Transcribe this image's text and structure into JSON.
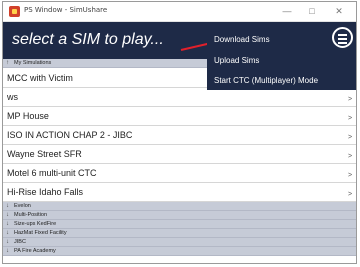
{
  "window": {
    "title": "PS Window - SimUshare",
    "minimize_glyph": "—",
    "maximize_glyph": "□",
    "close_glyph": "✕"
  },
  "header": {
    "title": "select a SIM to play..."
  },
  "menu": {
    "items": [
      {
        "label": "Download Sims"
      },
      {
        "label": "Upload Sims"
      },
      {
        "label": "Start CTC (Multiplayer) Mode"
      }
    ]
  },
  "my_simulations": {
    "caret": "↑",
    "label": "My Simulations",
    "items": [
      {
        "name": "MCC with Victim",
        "chevron": ">"
      },
      {
        "name": "ws",
        "chevron": ">"
      },
      {
        "name": "MP House",
        "chevron": ">"
      },
      {
        "name": "ISO IN ACTION CHAP 2 - JIBC",
        "chevron": ">"
      },
      {
        "name": "Wayne Street SFR",
        "chevron": ">"
      },
      {
        "name": "Motel 6 multi-unit CTC",
        "chevron": ">"
      },
      {
        "name": "Hi-Rise Idaho Falls",
        "chevron": ">"
      }
    ]
  },
  "groups": [
    {
      "caret": "↓",
      "label": "Evelon"
    },
    {
      "caret": "↓",
      "label": "Multi-Position"
    },
    {
      "caret": "↓",
      "label": "Size-ups KedFire"
    },
    {
      "caret": "↓",
      "label": "HazMat Fixed Facility"
    },
    {
      "caret": "↓",
      "label": "JIBC"
    },
    {
      "caret": "↓",
      "label": "PA Fire Academy"
    }
  ],
  "colors": {
    "header_bg": "#1e2a47",
    "section_bg": "#c6cbd7",
    "accent_line": "#e0202b"
  },
  "icons": {
    "app": "app-icon",
    "menu": "hamburger-menu-icon"
  }
}
